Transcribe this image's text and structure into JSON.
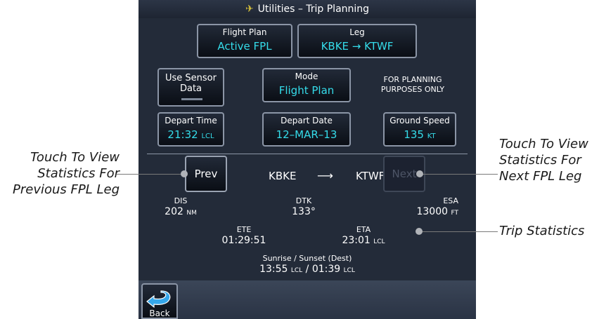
{
  "title": "Utilities – Trip Planning",
  "flight_plan": {
    "label": "Flight Plan",
    "value": "Active FPL"
  },
  "leg": {
    "label": "Leg",
    "value": "KBKE → KTWF"
  },
  "use_sensor": {
    "line1": "Use Sensor",
    "line2": "Data"
  },
  "mode": {
    "label": "Mode",
    "value": "Flight Plan"
  },
  "note": {
    "line1": "FOR PLANNING",
    "line2": "PURPOSES ONLY"
  },
  "depart_time": {
    "label": "Depart Time",
    "value": "21:32",
    "unit": "LCL"
  },
  "depart_date": {
    "label": "Depart Date",
    "value": "12–MAR–13"
  },
  "ground_speed": {
    "label": "Ground Speed",
    "value": "135",
    "unit": "KT"
  },
  "nav": {
    "prev": "Prev",
    "next": "Next",
    "from": "KBKE",
    "to": "KTWF"
  },
  "stats": {
    "dis": {
      "label": "DIS",
      "value": "202",
      "unit": "NM"
    },
    "dtk": {
      "label": "DTK",
      "value": "133°"
    },
    "esa": {
      "label": "ESA",
      "value": "13000",
      "unit": "FT"
    },
    "ete": {
      "label": "ETE",
      "value": "01:29:51"
    },
    "eta": {
      "label": "ETA",
      "value": "23:01",
      "unit": "LCL"
    },
    "sun": {
      "label": "Sunrise / Sunset (Dest)",
      "rise": "13:55",
      "set": "01:39",
      "unit": "LCL",
      "sep": "/"
    }
  },
  "back": {
    "label": "Back"
  },
  "callouts": {
    "prev": [
      "Touch To View",
      "Statistics For",
      "Previous FPL Leg"
    ],
    "next": [
      "Touch To View",
      "Statistics For",
      "Next FPL Leg"
    ],
    "trip": "Trip Statistics"
  },
  "colors": {
    "screen_bg": "#232b39",
    "value_cyan": "#35dcea",
    "plane_icon": "#d8c23a"
  }
}
